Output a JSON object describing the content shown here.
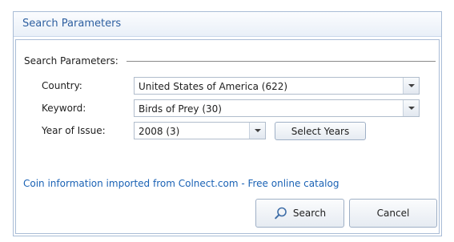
{
  "window": {
    "title": "Search Parameters"
  },
  "group": {
    "title": "Search Parameters:"
  },
  "fields": {
    "country": {
      "label": "Country:",
      "value": "United States of America (622)"
    },
    "keyword": {
      "label": "Keyword:",
      "value": "Birds of Prey (30)"
    },
    "year": {
      "label": "Year of Issue:",
      "value": "2008 (3)"
    }
  },
  "buttons": {
    "select_years": "Select Years",
    "search": "Search",
    "cancel": "Cancel"
  },
  "info_link": "Coin information imported from Colnect.com - Free online catalog",
  "icons": {
    "dropdown": "chevron-down-icon",
    "search": "magnifier-icon"
  },
  "colors": {
    "title_text": "#2d5fa0",
    "link": "#1a62b5",
    "border": "#a9bcd6"
  }
}
